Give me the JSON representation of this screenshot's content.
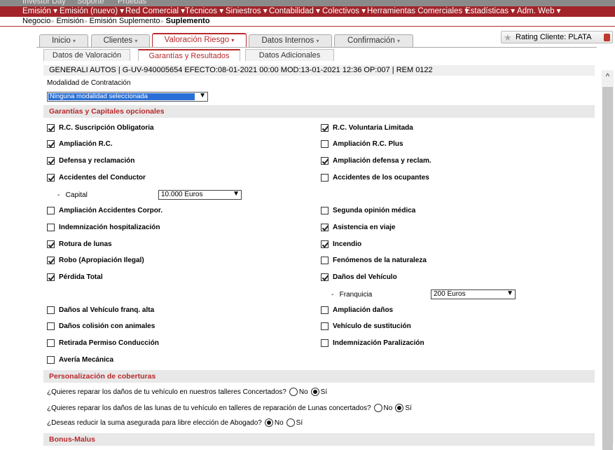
{
  "topmenu1": [
    "Investor Day",
    "Soporte",
    "Pruebas"
  ],
  "topmenu2": [
    "Emisión",
    "Emisión (nuevo)",
    "Red Comercial",
    "Técnicos",
    "Siniestros",
    "Contabilidad",
    "Colectivos",
    "Herramientas Comerciales",
    "Estadísticas",
    "Adm. Web"
  ],
  "breadcrumb": {
    "a": "Negocio",
    "b": "Emisión",
    "c": "Emisión Suplemento",
    "d": "Suplemento"
  },
  "tabs": [
    "Inicio",
    "Clientes",
    "Valoración Riesgo",
    "Datos Internos",
    "Confirmación"
  ],
  "subtabs": [
    "Datos de Valoración",
    "Garantías y Resultados",
    "Datos Adicionales"
  ],
  "rating": "Rating Cliente: PLATA",
  "policy_info": "GENERALI AUTOS | G-UV-940005654 EFECTO:08-01-2021 00:00 MOD:13-01-2021 12:36 OP:007 | REM 0122",
  "modalidad": {
    "label": "Modalidad de Contratación",
    "value": "Ninguna modalidad seleccionada"
  },
  "sections": {
    "garantias": "Garantías y Capitales opcionales",
    "personalizacion": "Personalización de coberturas",
    "bonus": "Bonus-Malus"
  },
  "left": [
    {
      "label": "R.C. Suscripción Obligatoria",
      "checked": true
    },
    {
      "label": "Ampliación R.C.",
      "checked": true
    },
    {
      "label": "Defensa y reclamación",
      "checked": true
    },
    {
      "label": "Accidentes del Conductor",
      "checked": true
    },
    {
      "label": "Ampliación Accidentes Corpor.",
      "checked": false
    },
    {
      "label": "Indemnización hospitalización",
      "checked": false
    },
    {
      "label": "Rotura de lunas",
      "checked": true
    },
    {
      "label": "Robo (Apropiación Ilegal)",
      "checked": true
    },
    {
      "label": "Pérdida Total",
      "checked": true
    },
    {
      "label": "Daños al Vehículo franq. alta",
      "checked": false
    },
    {
      "label": "Daños colisión con animales",
      "checked": false
    },
    {
      "label": "Retirada Permiso Conducción",
      "checked": false
    },
    {
      "label": "Avería Mecánica",
      "checked": false
    }
  ],
  "right": [
    {
      "label": "R.C. Voluntaria Limitada",
      "checked": true
    },
    {
      "label": "Ampliación R.C. Plus",
      "checked": false
    },
    {
      "label": "Ampliación defensa y reclam.",
      "checked": true
    },
    {
      "label": "Accidentes de los ocupantes",
      "checked": false
    },
    {
      "label": "Segunda opinión médica",
      "checked": false
    },
    {
      "label": "Asistencia en viaje",
      "checked": true
    },
    {
      "label": "Incendio",
      "checked": true
    },
    {
      "label": "Fenómenos de la naturaleza",
      "checked": false
    },
    {
      "label": "Daños del Vehículo",
      "checked": true
    },
    {
      "label": "Ampliación daños",
      "checked": false
    },
    {
      "label": "Vehículo de sustitución",
      "checked": false
    },
    {
      "label": "Indemnización Paralización",
      "checked": false
    }
  ],
  "capital": {
    "label": "Capital",
    "value": "10.000 Euros"
  },
  "franquicia": {
    "label": "Franquicia",
    "value": "200 Euros"
  },
  "questions": [
    {
      "text": "¿Quieres reparar los daños de tu vehículo en nuestros talleres Concertados?",
      "no": "No",
      "si": "Sí",
      "selected": "si"
    },
    {
      "text": "¿Quieres reparar los daños de las lunas de tu vehículo en talleres de reparación de Lunas concertados?",
      "no": "No",
      "si": "Sí",
      "selected": "si"
    },
    {
      "text": "¿Deseas reducir la suma asegurada para libre elección de Abogado?",
      "no": "No",
      "si": "Sí",
      "selected": "no"
    }
  ]
}
